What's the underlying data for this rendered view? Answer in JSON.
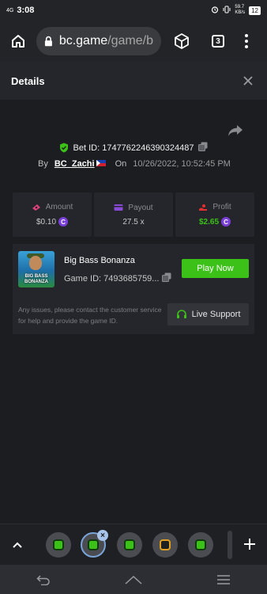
{
  "status_bar": {
    "network": "4G",
    "time": "3:08",
    "speed": "59.7",
    "speed_unit": "KB/s",
    "battery": "12"
  },
  "browser": {
    "url_host": "bc.game",
    "url_path": "/game/b",
    "tab_count": "3"
  },
  "modal": {
    "title": "Details"
  },
  "bet": {
    "bet_id": "Bet ID: 1747762246390324487",
    "by_label": "By",
    "username": "BC_Zachi",
    "on_label": "On",
    "datetime": "10/26/2022, 10:52:45 PM"
  },
  "stats": {
    "amount_label": "Amount",
    "amount_value": "$0.10",
    "payout_label": "Payout",
    "payout_value": "27.5 x",
    "profit_label": "Profit",
    "profit_value": "$2.65"
  },
  "game": {
    "thumb_line1": "BIG BASS",
    "thumb_line2": "BONANZA",
    "name": "Big Bass Bonanza",
    "game_id": "Game ID: 7493685759...",
    "play_label": "Play Now",
    "support_text": "Any issues, please contact the customer service for help and provide the game ID.",
    "support_label": "Live Support"
  },
  "tab_strip": {
    "close_badge": "×"
  },
  "colors": {
    "accent_green": "#3bc117",
    "coin_purple": "#7a3fd8",
    "background": "#1b1d21",
    "card": "#24262b"
  }
}
